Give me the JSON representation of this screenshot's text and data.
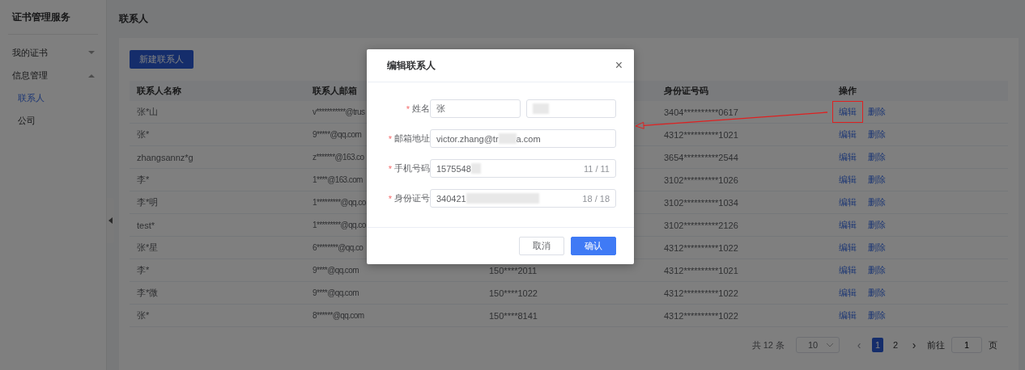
{
  "sidebar": {
    "title": "证书管理服务",
    "items": [
      {
        "label": "我的证书",
        "expanded": false,
        "selected": false
      },
      {
        "label": "信息管理",
        "expanded": true,
        "selected": false,
        "children": [
          {
            "label": "联系人",
            "selected": true
          },
          {
            "label": "公司",
            "selected": false
          }
        ]
      }
    ]
  },
  "page_title": "联系人",
  "new_button": "新建联系人",
  "table": {
    "columns": {
      "name": "联系人名称",
      "email": "联系人邮箱",
      "id_number": "身份证号码",
      "actions": "操作"
    },
    "rows": [
      {
        "name": "张*山",
        "email": "v***********@trus",
        "id_number": "3404**********0617",
        "actions": [
          "编辑",
          "删除"
        ]
      },
      {
        "name": "张*",
        "email": "9*****@qq.com",
        "id_number": "4312**********1021",
        "actions": [
          "编辑",
          "删除"
        ]
      },
      {
        "name": "zhangsannz*g",
        "email": "z*******@163.co",
        "id_number": "3654**********2544",
        "actions": [
          "编辑",
          "删除"
        ]
      },
      {
        "name": "李*",
        "email": "1****@163.com",
        "id_number": "3102**********1026",
        "actions": [
          "编辑",
          "删除"
        ]
      },
      {
        "name": "李*明",
        "email": "1*********@qq.co",
        "id_number": "3102**********1034",
        "actions": [
          "编辑",
          "删除"
        ]
      },
      {
        "name": "test*",
        "email": "1*********@qq.co",
        "id_number": "3102**********2126",
        "actions": [
          "编辑",
          "删除"
        ]
      },
      {
        "name": "张*星",
        "email": "6********@qq.co",
        "id_number": "4312**********1022",
        "actions": [
          "编辑",
          "删除"
        ]
      },
      {
        "name": "李*",
        "email": "9****@qq.com",
        "phone": "150****2011",
        "id_number": "4312**********1021",
        "actions": [
          "编辑",
          "删除"
        ]
      },
      {
        "name": "李*微",
        "email": "9****@qq.com",
        "phone": "150****1022",
        "id_number": "4312**********1022",
        "actions": [
          "编辑",
          "删除"
        ]
      },
      {
        "name": "张*",
        "email": "8******@qq.com",
        "phone": "150****8141",
        "id_number": "4312**********1022",
        "actions": [
          "编辑",
          "删除"
        ]
      }
    ]
  },
  "pagination": {
    "total": "共 12 条",
    "page_size": "10",
    "prev": "‹",
    "next": "›",
    "pages": [
      {
        "label": "1",
        "selected": true
      },
      {
        "label": "2",
        "selected": false
      }
    ],
    "goto_label": "前往",
    "goto_value": "1",
    "goto_suffix": "页"
  },
  "dialog": {
    "title": "编辑联系人",
    "close": "×",
    "required_mark": "*",
    "fields": [
      {
        "label": "姓名",
        "kind": "split",
        "required": true,
        "inputs": [
          {
            "value": "张",
            "redacted": false
          },
          {
            "redacted": true
          }
        ]
      },
      {
        "label": "邮箱地址",
        "kind": "text",
        "required": true,
        "value": "victor.zhang@tr",
        "redacted": true,
        "value_after": "a.com"
      },
      {
        "label": "手机号码",
        "kind": "text",
        "required": true,
        "value": "1575548",
        "redacted": true,
        "counter": "11 / 11"
      },
      {
        "label": "身份证号",
        "kind": "text",
        "required": true,
        "value": "340421",
        "redacted": true,
        "counter": "18 / 18"
      }
    ],
    "buttons": [
      {
        "label": "取消",
        "kind": "secondary"
      },
      {
        "label": "确认",
        "kind": "primary"
      }
    ]
  }
}
